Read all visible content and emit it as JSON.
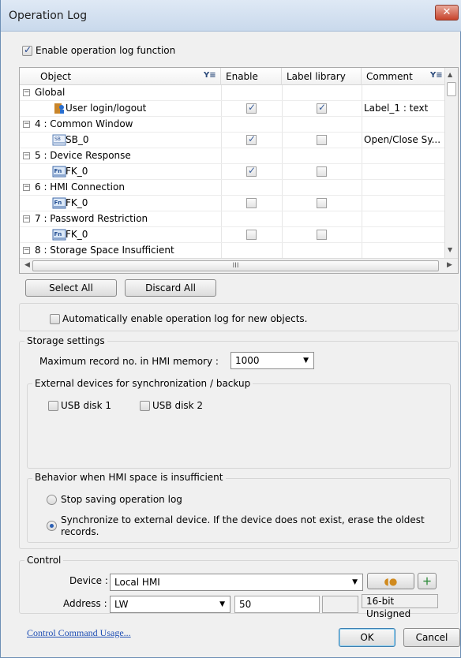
{
  "window": {
    "title": "Operation Log",
    "close_symbol": "✕"
  },
  "enable_log": {
    "label": "Enable operation log function",
    "checked": true
  },
  "grid": {
    "columns": [
      "Object",
      "Enable",
      "Label library",
      "Comment"
    ],
    "rows": [
      {
        "kind": "group",
        "text": "Global"
      },
      {
        "kind": "item",
        "text": "User login/logout",
        "icon": "user-login-icon",
        "enable": true,
        "label": true,
        "comment": "Label_1 : text"
      },
      {
        "kind": "group",
        "text": "4 : Common Window"
      },
      {
        "kind": "item",
        "text": "SB_0",
        "icon": "set-bit-icon",
        "enable": true,
        "label": false,
        "comment": "Open/Close Sy..."
      },
      {
        "kind": "group",
        "text": "5 : Device Response"
      },
      {
        "kind": "item",
        "text": "FK_0",
        "icon": "function-key-icon",
        "enable": true,
        "label": false,
        "comment": ""
      },
      {
        "kind": "group",
        "text": "6 : HMI Connection"
      },
      {
        "kind": "item",
        "text": "FK_0",
        "icon": "function-key-icon",
        "enable": false,
        "label": false,
        "comment": ""
      },
      {
        "kind": "group",
        "text": "7 : Password Restriction"
      },
      {
        "kind": "item",
        "text": "FK_0",
        "icon": "function-key-icon",
        "enable": false,
        "label": false,
        "comment": ""
      },
      {
        "kind": "group",
        "text": "8 : Storage Space Insufficient"
      }
    ],
    "hscroll_grip": "III"
  },
  "buttons": {
    "select_all": "Select All",
    "discard_all": "Discard All",
    "ok": "OK",
    "cancel": "Cancel"
  },
  "auto_enable": {
    "label": "Automatically enable operation log for new objects.",
    "checked": false
  },
  "storage": {
    "title": "Storage settings",
    "max_record_label": "Maximum record no. in HMI memory :",
    "max_record_value": "1000",
    "external_title": "External devices for synchronization / backup",
    "usb1": "USB disk 1",
    "usb2": "USB disk 2",
    "behavior_title": "Behavior when HMI space is insufficient",
    "opt_stop": "Stop saving operation log",
    "opt_sync_line1": "Synchronize to external device. If the device does not exist, erase the oldest",
    "opt_sync_line2": "records."
  },
  "control": {
    "title": "Control",
    "device_label": "Device :",
    "device_value": "Local HMI",
    "address_label": "Address :",
    "address_type": "LW",
    "address_value": "50",
    "data_format": "16-bit Unsigned"
  },
  "link": "Control Command Usage..."
}
